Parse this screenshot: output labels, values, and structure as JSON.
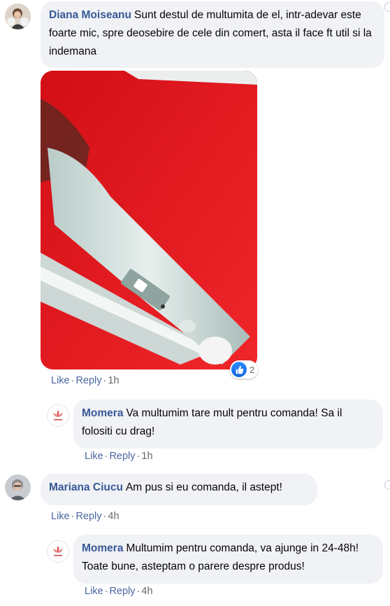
{
  "comments": [
    {
      "author": "Diana Moiseanu",
      "text": "Sunt destul de multumita de el, intr-adevar este foarte mic, spre deosebire de cele din comert, asta il face ft util si la indemana",
      "like": "Like",
      "reply": "Reply",
      "time": "1h",
      "reaction_count": "2",
      "replies": [
        {
          "author": "Momera",
          "text": "Va multumim tare mult pentru comanda! Sa il folositi cu drag!",
          "like": "Like",
          "reply": "Reply",
          "time": "1h"
        }
      ]
    },
    {
      "author": "Mariana Ciucu",
      "text": "Am pus si eu comanda, il astept!",
      "like": "Like",
      "reply": "Reply",
      "time": "4h",
      "replies": [
        {
          "author": "Momera",
          "text": "Multumim pentru comanda, va ajunge in 24-48h! Toate bune, asteptam o parere despre produs!",
          "like": "Like",
          "reply": "Reply",
          "time": "4h"
        }
      ]
    }
  ],
  "colors": {
    "bubble": "#f0f2f5",
    "author": "#385898",
    "link": "#4b67a1",
    "photo_background": "#e0141b",
    "like_blue": "#1877f2"
  }
}
